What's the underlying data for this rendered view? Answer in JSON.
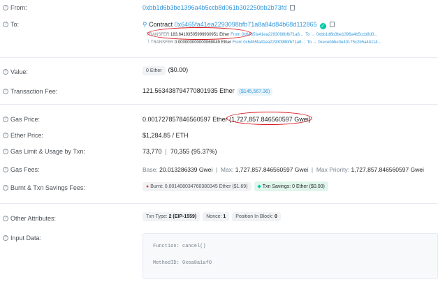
{
  "from": {
    "label": "From:",
    "address": "0xbb1d6b3be1396a4b5ccb8d061b302250bb2b73fd"
  },
  "to": {
    "label": "To:",
    "contract_prefix": "Contract",
    "contract_address": "0x6465fa41ea2293098bfb71a8a84d84b68d112865",
    "transfers": [
      {
        "tag": "TRANSFER",
        "amount": "183.64193505999930951 Ether",
        "from_text": "From 0x6465fa41ea2293098bfb71a8...",
        "to_text": "To → 0xbb1d6b3be1396a4b5ccb8d0..."
      },
      {
        "tag": "└ TRANSFER",
        "amount": "0.000000000000069049 Ether",
        "from_text": "From 0x6465fa41ea2293098bfb71a8...",
        "to_text": "To → 0xecebbbe3e40175c2b5a44114..."
      }
    ]
  },
  "value": {
    "label": "Value:",
    "amount": "0 Ether",
    "usd": "($0.00)"
  },
  "fee": {
    "label": "Transaction Fee:",
    "amount": "121.563438794770801935 Ether",
    "usd": "($145,567.36)"
  },
  "gas_price": {
    "label": "Gas Price:",
    "ether": "0.001727857846560597 Ether",
    "gwei": "(1,727,857.846560597 Gwei)"
  },
  "ether_price": {
    "label": "Ether Price:",
    "value": "$1,284.85 / ETH"
  },
  "gas_limit": {
    "label": "Gas Limit & Usage by Txn:",
    "limit": "73,770",
    "usage": "70,355 (95.37%)"
  },
  "gas_fees": {
    "label": "Gas Fees:",
    "base_label": "Base:",
    "base": "20.013286339 Gwei",
    "max_label": "Max:",
    "max": "1,727,857.846560597 Gwei",
    "priority_label": "Max Priority:",
    "priority": "1,727,857.846560597 Gwei"
  },
  "burnt": {
    "label": "Burnt & Txn Savings Fees:",
    "burnt_text": "Burnt: 0.001408034760380345 Ether ($1.69)",
    "savings_text": "Txn Savings: 0 Ether ($0.00)"
  },
  "other": {
    "label": "Other Attributes:",
    "txn_type_label": "Txn Type:",
    "txn_type": "2 (EIP-1559)",
    "nonce_label": "Nonce:",
    "nonce": "1",
    "position_label": "Position In Block:",
    "position": "0"
  },
  "input": {
    "label": "Input Data:",
    "function_line": "Function: cancel()",
    "method_line": "MethodID: 0xea8a1af0"
  },
  "colors": {
    "link": "#3498db",
    "annotation": "#d9141b",
    "green": "#00c9a7"
  }
}
